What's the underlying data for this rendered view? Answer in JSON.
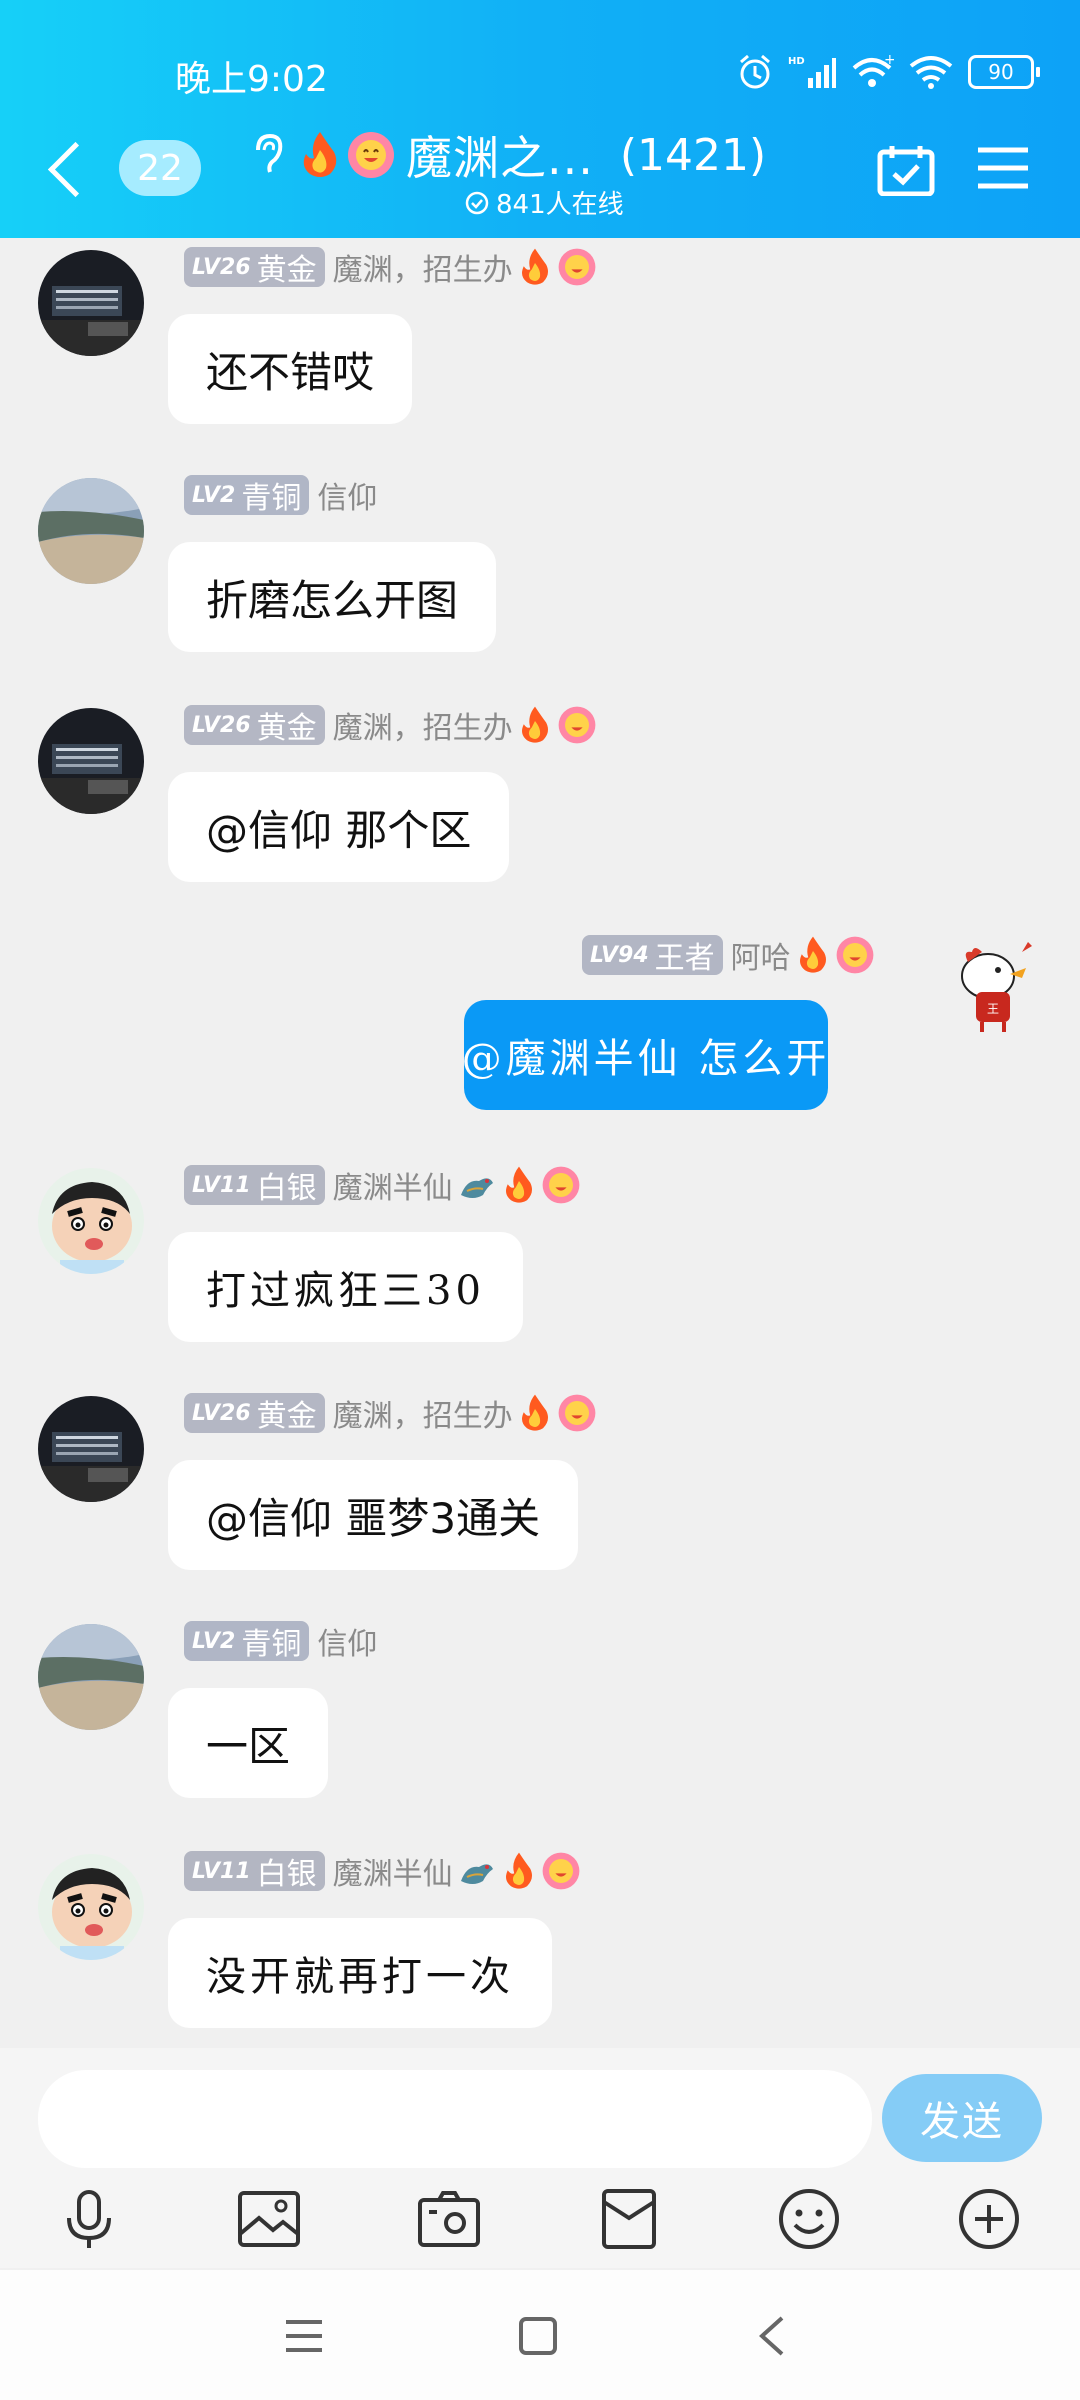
{
  "status_bar": {
    "time": "晚上9:02",
    "battery": "90"
  },
  "header": {
    "unread_count": "22",
    "title": "魔渊之...",
    "member_count": "(1421)",
    "online_text": "841人在线"
  },
  "messages": [
    {
      "level": "LV26",
      "rank": "黄金",
      "name": "魔渊，招生办",
      "text": "还不错哎"
    },
    {
      "level": "LV2",
      "rank": "青铜",
      "name": "信仰",
      "text": "折磨怎么开图"
    },
    {
      "level": "LV26",
      "rank": "黄金",
      "name": "魔渊，招生办",
      "text": "@信仰 那个区"
    },
    {
      "level": "LV94",
      "rank": "王者",
      "name": "阿哈",
      "text": "@魔渊半仙 怎么开"
    },
    {
      "level": "LV11",
      "rank": "白银",
      "name": "魔渊半仙",
      "text": "打过疯狂三30"
    },
    {
      "level": "LV26",
      "rank": "黄金",
      "name": "魔渊，招生办",
      "text": "@信仰 噩梦3通关"
    },
    {
      "level": "LV2",
      "rank": "青铜",
      "name": "信仰",
      "text": "一区"
    },
    {
      "level": "LV11",
      "rank": "白银",
      "name": "魔渊半仙",
      "text": "没开就再打一次"
    }
  ],
  "input": {
    "placeholder": "",
    "send_label": "发送"
  },
  "colors": {
    "accent": "#0a99f6",
    "header_start": "#16d0f8",
    "send_button": "#85ccf6"
  }
}
